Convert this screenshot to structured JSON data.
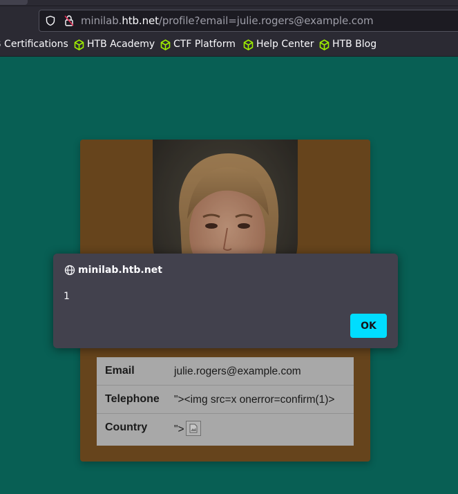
{
  "browser": {
    "url_prefix": "minilab.",
    "url_host": "htb.net",
    "url_path": "/profile?email=julie.rogers@example.com",
    "bookmarks": [
      {
        "label": "B Certifications"
      },
      {
        "label": "HTB Academy"
      },
      {
        "label": "CTF Platform"
      },
      {
        "label": "Help Center"
      },
      {
        "label": "HTB Blog"
      }
    ],
    "bookmark_icon_color": "#9fef00"
  },
  "profile": {
    "background_color": "#0b7a6c",
    "card_color": "#835825",
    "rows": [
      {
        "label": "Email",
        "value": "julie.rogers@example.com"
      },
      {
        "label": "Telephone",
        "value": "\"><img src=x onerror=confirm(1)>"
      },
      {
        "label": "Country",
        "value": "\">"
      }
    ]
  },
  "dialog": {
    "title": "minilab.htb.net",
    "message": "1",
    "ok_label": "OK",
    "accent_color": "#00ddff"
  }
}
